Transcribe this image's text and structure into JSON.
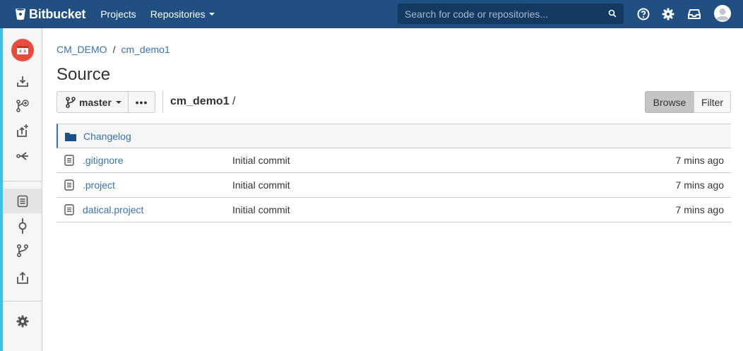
{
  "header": {
    "logo": "Bitbucket",
    "nav": [
      {
        "label": "Projects"
      },
      {
        "label": "Repositories"
      }
    ],
    "search_placeholder": "Search for code or repositories..."
  },
  "breadcrumb": {
    "project": "CM_DEMO",
    "separator": "/",
    "repo": "cm_demo1"
  },
  "page": {
    "title": "Source"
  },
  "toolbar": {
    "branch": "master",
    "more_label": "•••",
    "path_repo": "cm_demo1",
    "path_sep": "/",
    "browse_label": "Browse",
    "filter_label": "Filter"
  },
  "files": [
    {
      "name": "Changelog",
      "type": "folder",
      "commit": "",
      "age": ""
    },
    {
      "name": ".gitignore",
      "type": "file",
      "commit": "Initial commit",
      "age": "7 mins ago"
    },
    {
      "name": ".project",
      "type": "file",
      "commit": "Initial commit",
      "age": "7 mins ago"
    },
    {
      "name": "datical.project",
      "type": "file",
      "commit": "Initial commit",
      "age": "7 mins ago"
    }
  ],
  "colors": {
    "header_bg": "#205081",
    "link": "#3572b0",
    "sidebar_accent": "#3ec1ec",
    "repo_avatar": "#e74c3c"
  }
}
